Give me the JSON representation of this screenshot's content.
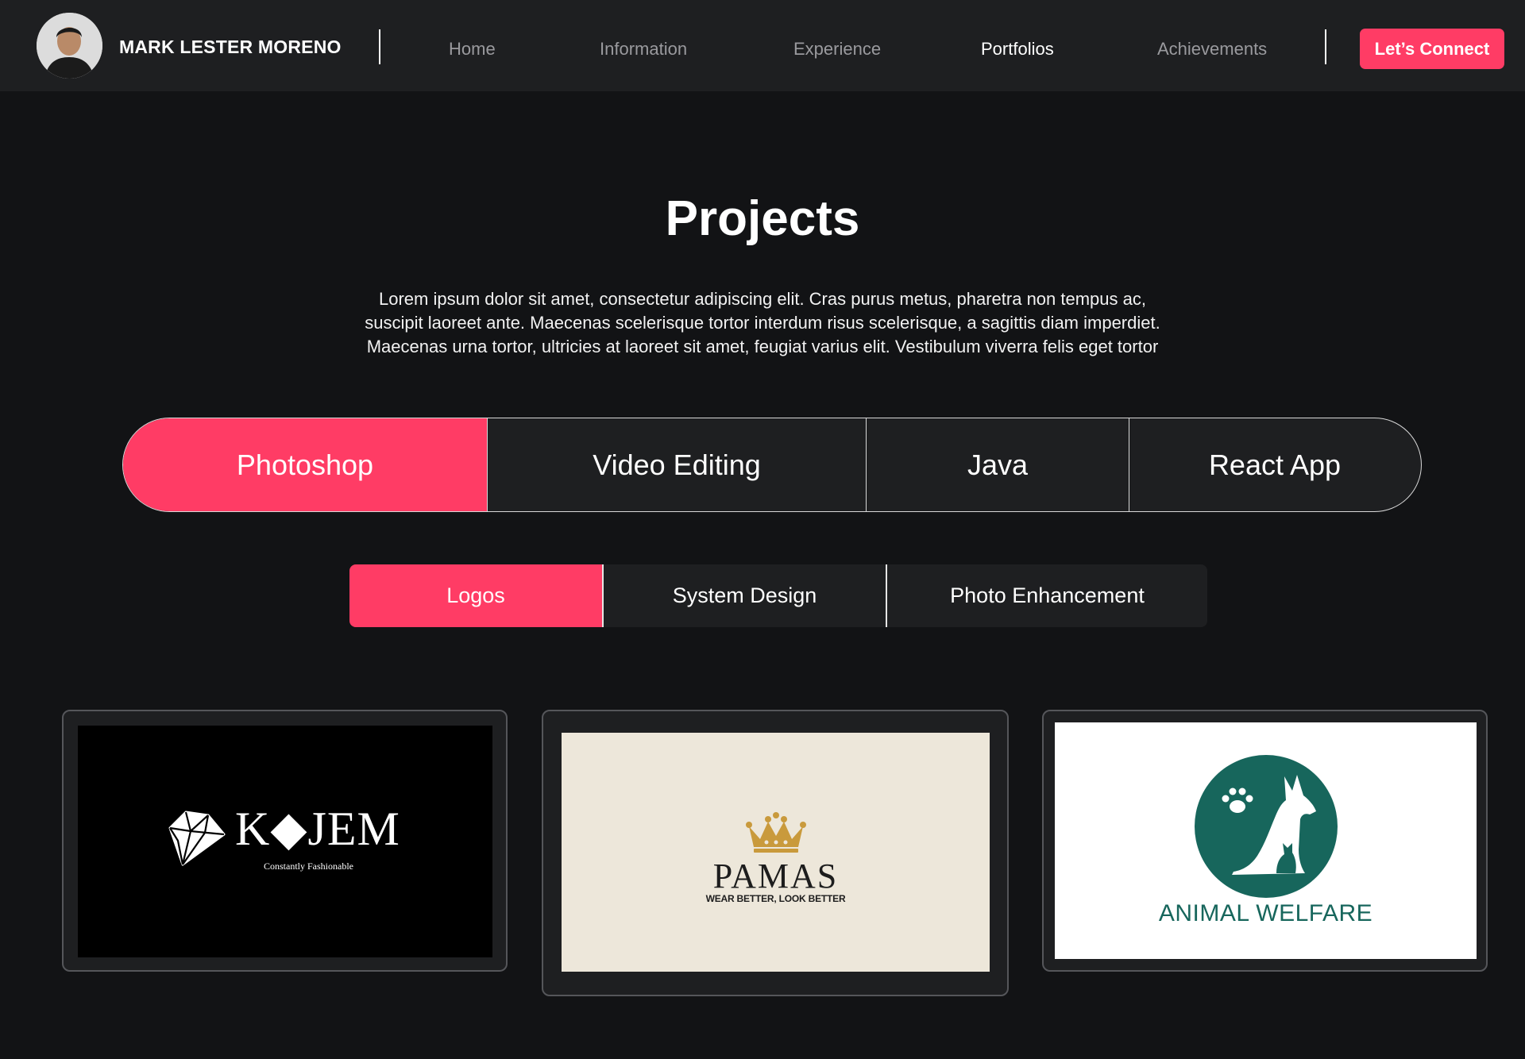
{
  "header": {
    "name": "MARK LESTER MORENO",
    "nav": [
      {
        "label": "Home",
        "active": false
      },
      {
        "label": "Information",
        "active": false
      },
      {
        "label": "Experience",
        "active": false
      },
      {
        "label": "Portfolios",
        "active": true
      },
      {
        "label": "Achievements",
        "active": false
      }
    ],
    "cta_label": "Let’s Connect"
  },
  "section": {
    "title": "Projects",
    "intro_lines": [
      "Lorem ipsum dolor sit amet, consectetur adipiscing elit. Cras purus metus, pharetra non tempus ac,",
      "suscipit laoreet ante. Maecenas scelerisque tortor interdum risus scelerisque, a sagittis diam imperdiet.",
      "Maecenas urna tortor, ultricies at laoreet sit amet, feugiat varius elit. Vestibulum viverra felis eget tortor"
    ]
  },
  "category_tabs": [
    {
      "label": "Photoshop",
      "active": true
    },
    {
      "label": "Video Editing",
      "active": false
    },
    {
      "label": "Java",
      "active": false
    },
    {
      "label": "React App",
      "active": false
    }
  ],
  "sub_tabs": [
    {
      "label": "Logos",
      "active": true
    },
    {
      "label": "System Design",
      "active": false
    },
    {
      "label": "Photo Enhancement",
      "active": false
    }
  ],
  "portfolio": [
    {
      "logo_text": "K◆JEM",
      "tagline": "Constantly Fashionable",
      "icon": "diamond-icon"
    },
    {
      "logo_text": "PAMAS",
      "tagline": "WEAR BETTER, LOOK BETTER",
      "icon": "crown-icon"
    },
    {
      "logo_text": "ANIMAL WELFARE",
      "icon": "dog-cat-paw-icon"
    }
  ],
  "colors": {
    "accent": "#ff3c65",
    "background": "#121315",
    "surface": "#1e1f21",
    "nav_inactive": "#9a9a9e",
    "animal_welfare_green": "#17665c",
    "pamas_cream": "#ede7da",
    "pamas_gold": "#c99a3c"
  }
}
